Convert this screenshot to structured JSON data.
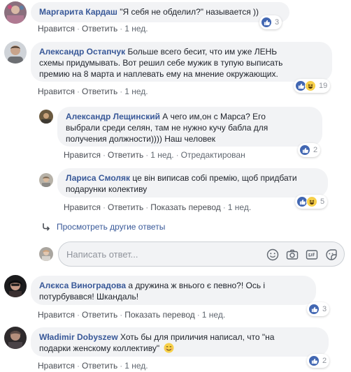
{
  "comments": [
    {
      "author": "Маргарита Кардаш",
      "text": "\"Я себя не обделил?\" называется ))",
      "actions": [
        "Нравится",
        "Ответить",
        "1 нед."
      ],
      "reactions": "3"
    },
    {
      "author": "Александр Остапчук",
      "text_line1": "Больше всего бесит, что им уже ЛЕНЬ",
      "text_line2": "схемы придумывать. Вот решил себе мужик в тупую выписать",
      "text_line3": "премию на 8 марта и наплевать ему на мнение окружающих.",
      "actions": [
        "Нравится",
        "Ответить",
        "1 нед."
      ],
      "reactions": "19"
    },
    {
      "author": "Александр Лещинский",
      "text_line1": "А чего им,он с Марса? Его",
      "text_line2": "выбрали среди селян, там не нужно кучу бабла для",
      "text_line3": "получения должности)))) Наш человек",
      "actions": [
        "Нравится",
        "Ответить",
        "1 нед.",
        "Отредактирован"
      ],
      "reactions": "2"
    },
    {
      "author": "Лариса Смоляк",
      "text_line1": "це він виписав собі премію, щоб придбати",
      "text_line2": "подарунки колективу",
      "actions": [
        "Нравится",
        "Ответить",
        "Показать перевод",
        "1 нед."
      ],
      "reactions": "5"
    },
    {
      "author": "Алєкса Виноградова",
      "text_line1": "а дружина ж внього є певно?! Ось і",
      "text_line2": "потурбувався! Шкандаль!",
      "actions": [
        "Нравится",
        "Ответить",
        "Показать перевод",
        "1 нед."
      ],
      "reactions": "3"
    },
    {
      "author": "Władimir Dobyszew",
      "text_line1": "Хоть бы для приличия написал, что \"на",
      "text_line2": "подарки женскому коллективу\"",
      "actions": [
        "Нравится",
        "Ответить",
        "1 нед."
      ],
      "reactions": "2"
    }
  ],
  "more_replies": "Просмотреть другие ответы",
  "composer": {
    "placeholder": "Написать ответ..."
  },
  "colors": {
    "link": "#385898",
    "bubble": "#f2f3f5",
    "like": "#4267b2",
    "meta": "#606770"
  },
  "icons": [
    "like-icon",
    "haha-icon",
    "reply-arrow-icon",
    "emoji-icon",
    "camera-icon",
    "gif-icon",
    "sticker-icon"
  ]
}
